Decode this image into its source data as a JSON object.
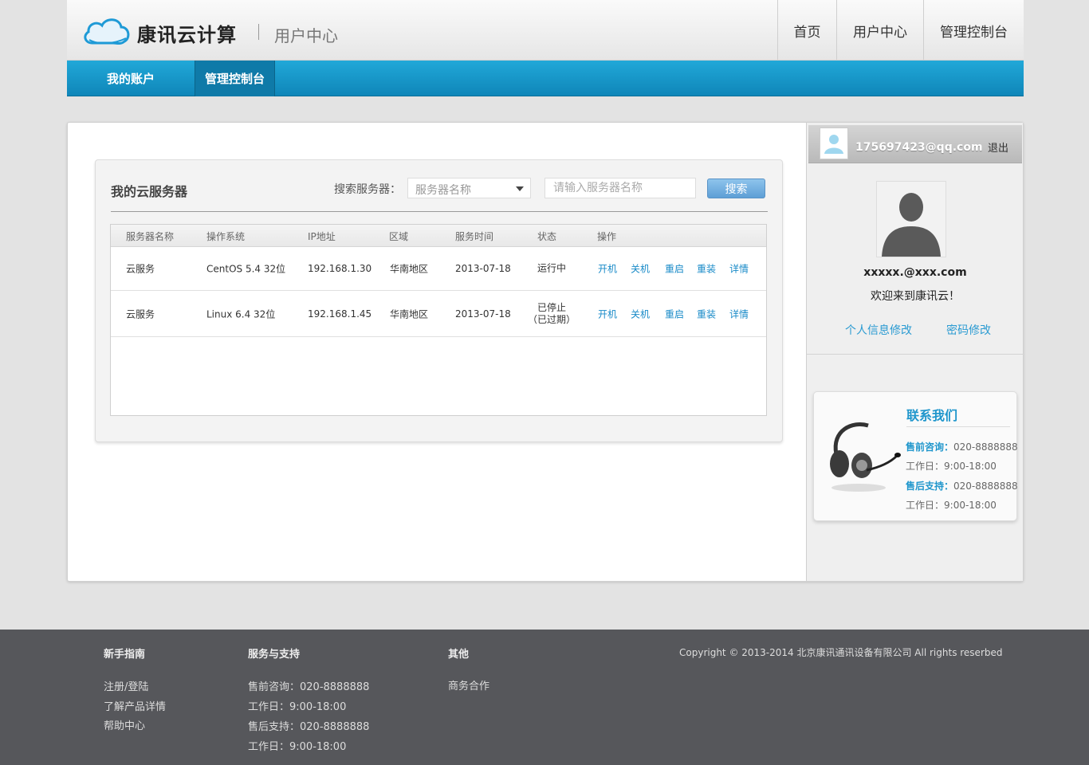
{
  "header": {
    "brand": "康讯云计算",
    "subtitle": "用户中心",
    "nav": [
      "首页",
      "用户中心",
      "管理控制台"
    ]
  },
  "subnav": {
    "items": [
      "我的账户",
      "管理控制台"
    ],
    "active": "管理控制台"
  },
  "panel": {
    "title": "我的云服务器",
    "search_label": "搜索服务器：",
    "select_value": "服务器名称",
    "input_placeholder": "请输入服务器名称",
    "search_button": "搜索"
  },
  "table": {
    "columns": [
      "服务器名称",
      "操作系统",
      "IP地址",
      "区域",
      "服务时间",
      "状态",
      "操作"
    ],
    "rows": [
      {
        "name": "云服务",
        "os": "CentOS 5.4 32位",
        "ip": "192.168.1.30",
        "region": "华南地区",
        "date": "2013-07-18",
        "status_line1": "运行中",
        "status_line2": ""
      },
      {
        "name": "云服务",
        "os": "Linux 6.4 32位",
        "ip": "192.168.1.45",
        "region": "华南地区",
        "date": "2013-07-18",
        "status_line1": "已停止",
        "status_line2": "（已过期）"
      }
    ],
    "actions": [
      "开机",
      "关机",
      "重启",
      "重装",
      "详情"
    ]
  },
  "sidebar": {
    "user_email": "175697423@qq.com",
    "logout": "退出",
    "account_email": "xxxxx.@xxx.com",
    "welcome": "欢迎来到康讯云！",
    "links": [
      "个人信息修改",
      "密码修改"
    ],
    "contact": {
      "title": "联系我们",
      "presale_label": "售前咨询：",
      "presale_phone": "020-8888888",
      "hours_label": "工作日：",
      "hours": "9:00-18:00",
      "aftersale_label": "售后支持：",
      "aftersale_phone": "020-8888888"
    }
  },
  "footer": {
    "col1": {
      "title": "新手指南",
      "items": [
        "注册/登陆",
        "了解产品详情",
        "帮助中心"
      ]
    },
    "col2": {
      "title": "服务与支持",
      "items": [
        "售前咨询：020-8888888",
        "工作日：9:00-18:00",
        "售后支持：020-8888888",
        "工作日：9:00-18:00"
      ]
    },
    "col3": {
      "title": "其他",
      "items": [
        "商务合作"
      ]
    },
    "copyright": "Copyright © 2013-2014  北京康讯通讯设备有限公司   All rights reserbed"
  },
  "colors": {
    "accent_blue": "#1a8bc8",
    "bar_blue": "#1596c9",
    "footer_bg": "#56575b"
  }
}
